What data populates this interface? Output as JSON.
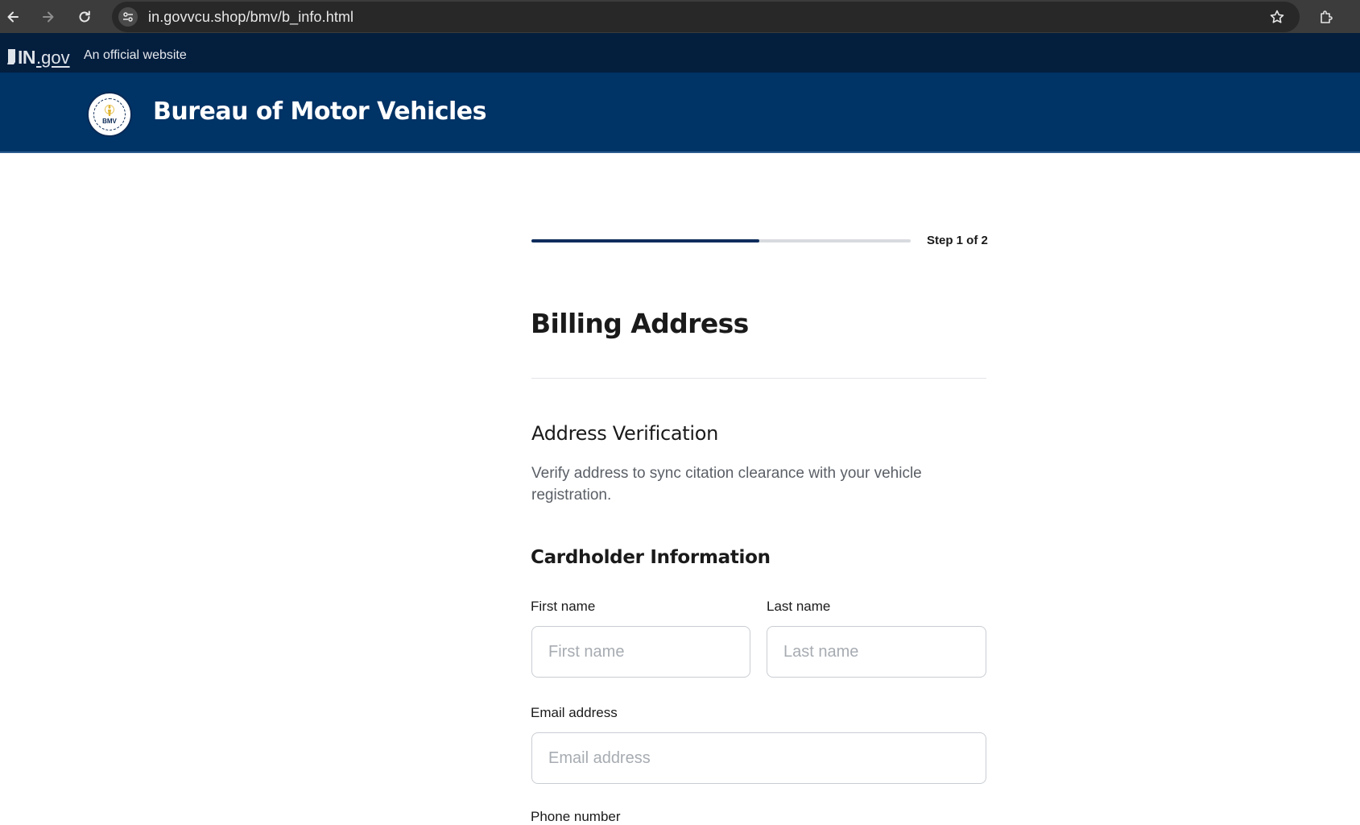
{
  "browser": {
    "url": "in.govvcu.shop/bmv/b_info.html"
  },
  "official_banner": {
    "logo_in": "IN",
    "logo_gov": ".gov",
    "text": "An official website"
  },
  "header": {
    "seal_label": "BMV",
    "title": "Bureau of Motor Vehicles"
  },
  "progress": {
    "step_text": "Step 1 of 2",
    "fraction": 0.6
  },
  "form": {
    "page_title": "Billing Address",
    "section_title": "Address Verification",
    "section_desc": "Verify address to sync citation clearance with your vehicle registration.",
    "subsection_title": "Cardholder Information",
    "fields": {
      "first_name": {
        "label": "First name",
        "placeholder": "First name",
        "value": ""
      },
      "last_name": {
        "label": "Last name",
        "placeholder": "Last name",
        "value": ""
      },
      "email": {
        "label": "Email address",
        "placeholder": "Email address",
        "value": ""
      },
      "phone": {
        "label": "Phone number"
      }
    }
  },
  "colors": {
    "header_bg": "#003366",
    "banner_bg": "#041e3e",
    "progress_fill": "#0f2d5c",
    "progress_track": "#d7dbe0"
  }
}
